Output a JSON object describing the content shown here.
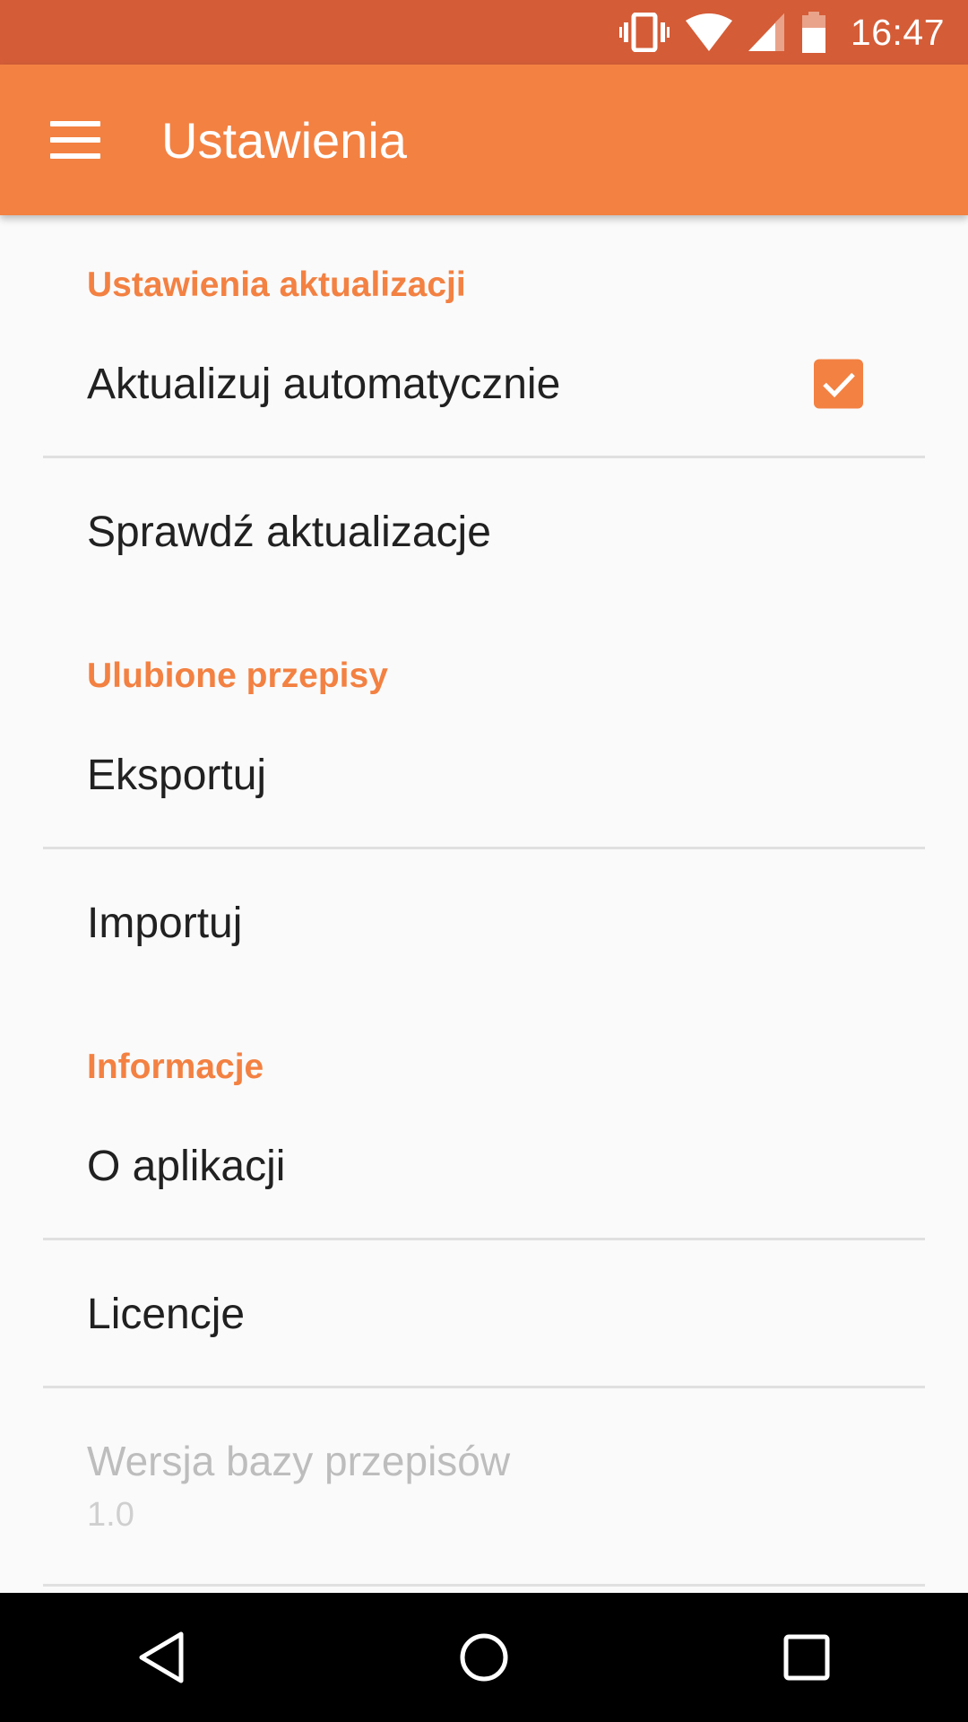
{
  "status_bar": {
    "time": "16:47",
    "icons": [
      "vibrate-icon",
      "wifi-icon",
      "signal-icon",
      "battery-icon"
    ],
    "color": "#d45d38"
  },
  "app_bar": {
    "title": "Ustawienia",
    "menu_icon": "hamburger-menu-icon",
    "color": "#f38142"
  },
  "sections": [
    {
      "title": "Ustawienia aktualizacji",
      "items": [
        {
          "label": "Aktualizuj automatycznie",
          "checked": true
        },
        {
          "label": "Sprawdź aktualizacje"
        }
      ]
    },
    {
      "title": "Ulubione przepisy",
      "items": [
        {
          "label": "Eksportuj"
        },
        {
          "label": "Importuj"
        }
      ]
    },
    {
      "title": "Informacje",
      "items": [
        {
          "label": "O aplikacji"
        },
        {
          "label": "Licencje"
        },
        {
          "label": "Wersja bazy przepisów",
          "summary": "1.0",
          "enabled": false
        }
      ]
    }
  ],
  "nav_bar": {
    "buttons": [
      "back-icon",
      "home-icon",
      "recents-icon"
    ]
  },
  "accent_color": "#f38142"
}
